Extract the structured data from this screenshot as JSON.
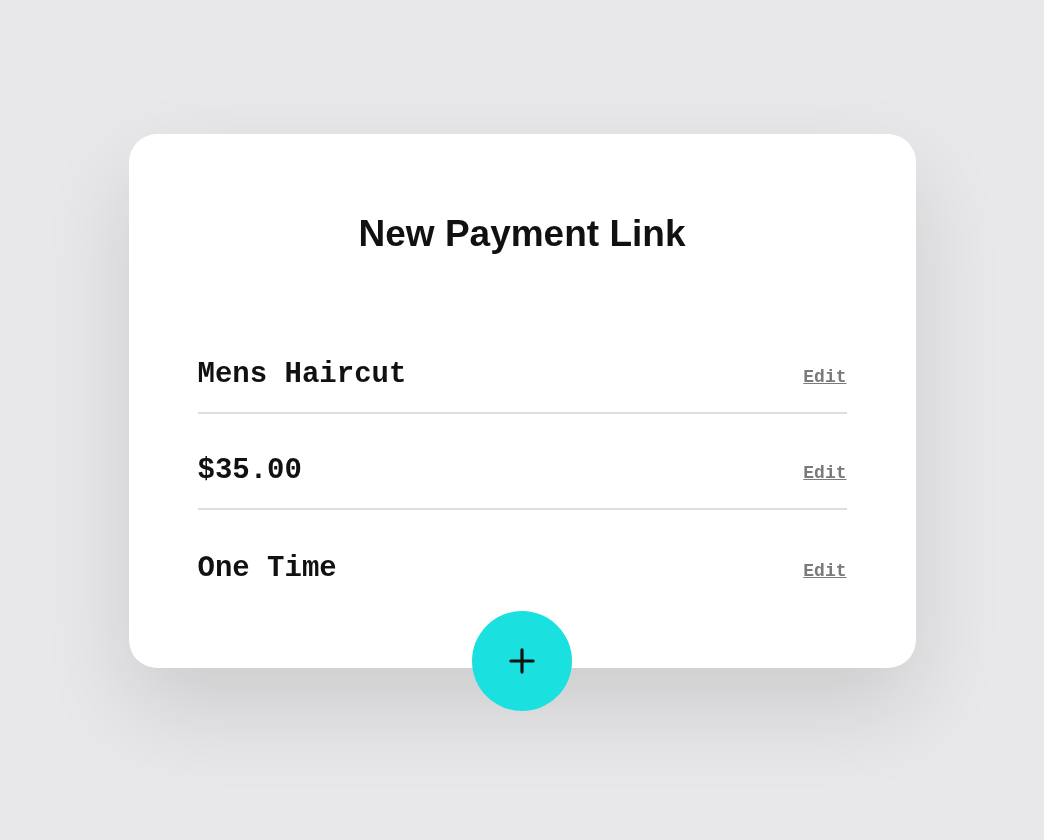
{
  "card": {
    "title": "New Payment Link",
    "rows": [
      {
        "label": "Mens Haircut",
        "action": "Edit"
      },
      {
        "label": "$35.00",
        "action": "Edit"
      },
      {
        "label": "One Time",
        "action": "Edit"
      }
    ]
  }
}
